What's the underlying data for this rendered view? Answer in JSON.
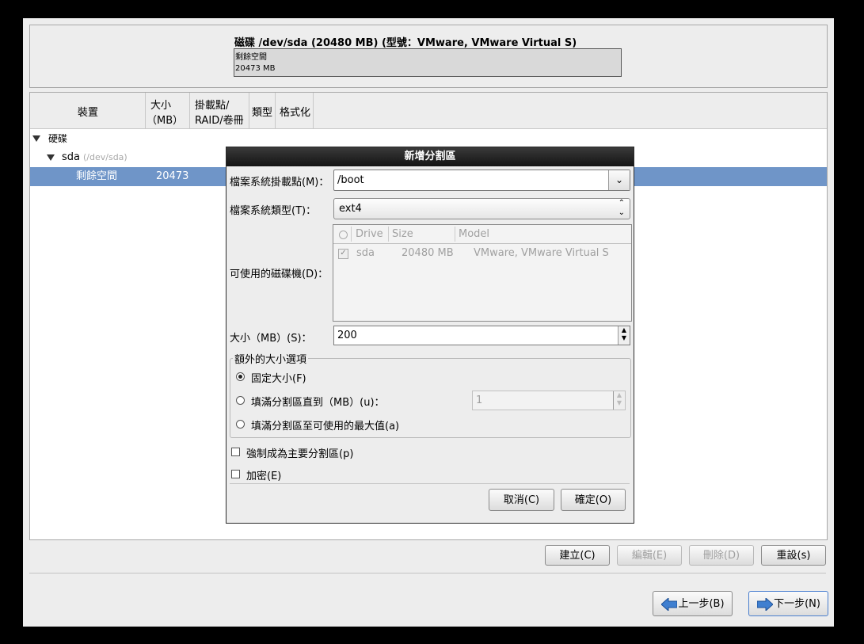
{
  "disk": {
    "title": "磁碟 /dev/sda (20480 MB) (型號：VMware, VMware Virtual S)",
    "free_label": "剩餘空間",
    "free_size": "20473 MB"
  },
  "tree": {
    "columns": {
      "device": "裝置",
      "size_line1": "大小",
      "size_line2": "（MB）",
      "mount_line1": "掛載點/",
      "mount_line2": "RAID/卷冊",
      "type": "類型",
      "format": "格式化"
    },
    "group_label": "硬碟",
    "disk_name": "sda",
    "disk_path": "(/dev/sda)",
    "free_row": {
      "label": "剩餘空間",
      "size": "20473"
    }
  },
  "buttons": {
    "create": "建立(C)",
    "edit": "編輯(E)",
    "delete": "刪除(D)",
    "reset": "重設(s)",
    "back": "上一步(B)",
    "next": "下一步(N)"
  },
  "dialog": {
    "title": "新增分割區",
    "mount_label": "檔案系統掛載點(M)：",
    "mount_value": "/boot",
    "fstype_label": "檔案系統類型(T)：",
    "fstype_value": "ext4",
    "drives_label": "可使用的磁碟機(D)：",
    "drives_table": {
      "headers": [
        "Drive",
        "Size",
        "Model"
      ],
      "rows": [
        {
          "drive": "sda",
          "size": "20480 MB",
          "model": "VMware, VMware Virtual S",
          "checked": true
        }
      ]
    },
    "size_label": "大小（MB）(S)：",
    "size_value": "200",
    "extra_group_label": "額外的大小選項",
    "opt_fixed": "固定大小(F)",
    "opt_fill_upto": "填滿分割區直到（MB）(u)：",
    "fill_upto_value": "1",
    "opt_fill_max": "填滿分割區至可使用的最大值(a)",
    "force_primary": "強制成為主要分割區(p)",
    "encrypt": "加密(E)",
    "cancel": "取消(C)",
    "ok": "確定(O)"
  },
  "colors": {
    "selection": "#6f95c8",
    "dialog_title_bg": "#1f1f1f",
    "background": "#ededed"
  }
}
